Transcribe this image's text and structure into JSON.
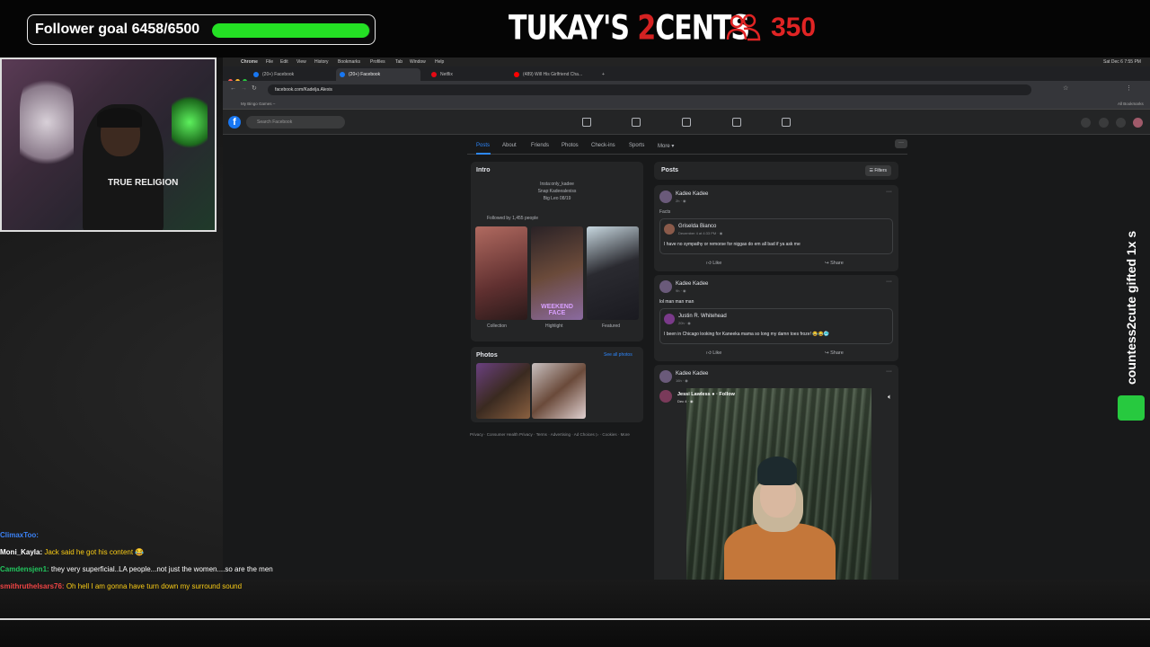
{
  "overlay": {
    "follower_goal_label": "Follower goal 6458/6500",
    "follower_goal_progress": 0.9935,
    "brand_part1": "TUKAY'S ",
    "brand_two": "2",
    "brand_part2": "CENTS",
    "viewer_count": "350",
    "side_gift": "countess2cute gifted 1x s",
    "webcam_shirt_text": "TRUE RELIGION"
  },
  "chat": [
    {
      "user": "ClimaxToo:",
      "user_color": "#3b82f6",
      "message": ""
    },
    {
      "user": "Moni_Kayla:",
      "user_color": "#ffffff",
      "message": "Jack said he got his content 😂"
    },
    {
      "user": "Camdensjen1:",
      "user_color": "#22c55e",
      "message": "they very superficial..LA people...not just the women....so are the men"
    },
    {
      "user": "smithruthelsars76:",
      "user_color": "#ef4444",
      "message": "Oh hell I am gonna have turn down my surround sound"
    }
  ],
  "mac_menu": [
    "Chrome",
    "File",
    "Edit",
    "View",
    "History",
    "Bookmarks",
    "Profiles",
    "Tab",
    "Window",
    "Help"
  ],
  "mac_clock": "Sat Dec 6 7:55 PM",
  "browser": {
    "tabs": [
      {
        "label": "(20+) Facebook",
        "active": false,
        "icon_color": "#1877f2"
      },
      {
        "label": "(20+) Facebook",
        "active": true,
        "icon_color": "#1877f2"
      },
      {
        "label": "Netflix",
        "active": false,
        "icon_color": "#e50914"
      },
      {
        "label": "(489) Will His Girlfriend Cha...",
        "active": false,
        "icon_color": "#ff0000"
      }
    ],
    "url": "facebook.com/Kadelja.Alexis",
    "bookmark_left": "My Bingo Games –",
    "bookmark_right": "All Bookmarks"
  },
  "facebook": {
    "search_placeholder": "Search Facebook",
    "profile_tabs": [
      "Posts",
      "About",
      "Friends",
      "Photos",
      "Check-ins",
      "Sports",
      "More ▾"
    ],
    "intro_title": "Intro",
    "intro_lines": [
      "Insta:only_kadee",
      "Snap:Kadeealexiss",
      "Big Leo 08/19"
    ],
    "followed_by": "Followed by 1,455 people",
    "highlights": [
      "Collection",
      "Highlight",
      "Featured"
    ],
    "highlight_overlay": "WEEKEND FACE",
    "photos_title": "Photos",
    "see_all_photos": "See all photos",
    "footer": "Privacy · Consumer Health Privacy · Terms · Advertising · Ad Choices ▷ · Cookies · More",
    "posts_title": "Posts",
    "filters_label": "Filters",
    "posts": [
      {
        "author": "Kadee Kadee",
        "time": "2h · ◉",
        "text": "Facts",
        "shared_author": "Griselda Bianco",
        "shared_time": "December 4 at 4:33 PM · ◉",
        "shared_text": "I have no sympathy or remorse for niggas do em all bad if ya ask me"
      },
      {
        "author": "Kadee Kadee",
        "time": "9h · ◉",
        "text": "lol man man man",
        "shared_author": "Justin R. Whitehead",
        "shared_time": "20h · ◉",
        "shared_text": "I been in Chicago looking for Kaneeka mama so long my damn toes froze! 😂😂🥶"
      },
      {
        "author": "Kadee Kadee",
        "time": "16h · ◉",
        "video_author": "Jessi Lawless ● · Follow",
        "video_time": "Dec 4 · ◉"
      }
    ],
    "like_label": "Like",
    "share_label": "Share"
  }
}
